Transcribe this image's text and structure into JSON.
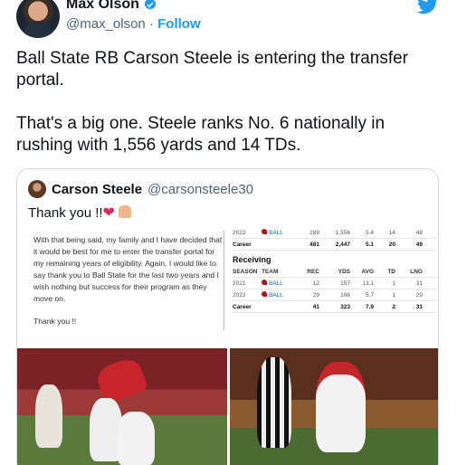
{
  "header": {
    "name": "Max Olson",
    "handle": "@max_olson",
    "separator": "·",
    "follow_label": "Follow"
  },
  "tweet": {
    "paragraph1": "Ball State RB Carson Steele is entering the transfer portal.",
    "paragraph2": "That's a big one. Steele ranks No. 6 nationally in rushing with 1,556 yards and 14 TDs."
  },
  "quote": {
    "name": "Carson Steele",
    "handle": "@carsonsteele30",
    "text": "Thank you !!",
    "statement": "With that being said, my family and I have decided that it would be best for me to enter the transfer portal for my remaining years of eligibility. Again, I would like to say thank you to Ball State for the last two years and I wish nothing but success for their program as they move on.",
    "closing": "Thank you !!",
    "rushing_rows": [
      {
        "season": "2022",
        "team": "BALL",
        "c3": "289",
        "c4": "1,556",
        "c5": "5.4",
        "c6": "14",
        "c7": "48"
      }
    ],
    "rushing_career": {
      "label": "Career",
      "c3": "481",
      "c4": "2,447",
      "c5": "5.1",
      "c6": "20",
      "c7": "49"
    },
    "receiving": {
      "title": "Receiving",
      "headers": [
        "SEASON",
        "TEAM",
        "REC",
        "YDS",
        "AVG",
        "TD",
        "LNG"
      ],
      "rows": [
        {
          "season": "2021",
          "team": "BALL",
          "c3": "12",
          "c4": "157",
          "c5": "13.1",
          "c6": "1",
          "c7": "31"
        },
        {
          "season": "2022",
          "team": "BALL",
          "c3": "29",
          "c4": "166",
          "c5": "5.7",
          "c6": "1",
          "c7": "29"
        }
      ],
      "career": {
        "label": "Career",
        "c3": "41",
        "c4": "323",
        "c5": "7.9",
        "c6": "2",
        "c7": "31"
      }
    }
  },
  "colors": {
    "accent": "#1d9bf0",
    "text": "#0f1419",
    "muted": "#536471",
    "heart": "#e0245e"
  },
  "icons": {
    "verified": "verified-badge-icon",
    "twitter": "twitter-bird-icon",
    "heart": "red-heart-emoji",
    "pray": "folded-hands-emoji"
  }
}
